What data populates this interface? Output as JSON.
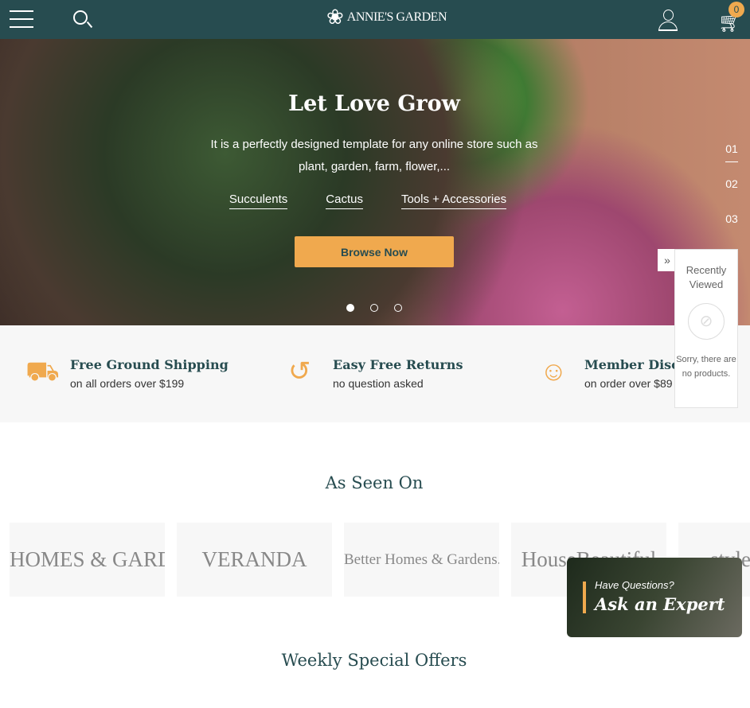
{
  "header": {
    "brand": "ANNIE'S GARDEN",
    "cart_count": "0"
  },
  "hero": {
    "title": "Let Love Grow",
    "subtitle": "It is a perfectly designed template for any online store such as plant, garden, farm, flower,...",
    "links": [
      "Succulents",
      "Cactus",
      "Tools + Accessories"
    ],
    "cta": "Browse Now",
    "slide_numbers": [
      "01",
      "02",
      "03"
    ],
    "active_slide": 1
  },
  "features": [
    {
      "title": "Free Ground Shipping",
      "text": "on all orders over $199",
      "icon": "truck-icon"
    },
    {
      "title": "Easy Free Returns",
      "text": "no question asked",
      "icon": "return-icon"
    },
    {
      "title": "Member Discount",
      "text": "on order over $89",
      "icon": "member-tag-icon"
    }
  ],
  "recently_viewed": {
    "title": "Recently Viewed",
    "empty": "Sorry, there are no products."
  },
  "as_seen_on": {
    "title": "As Seen On",
    "logos": [
      "HOMES & GARDENS",
      "VERANDA",
      "Better Homes & Gardens.",
      "HouseBeautiful",
      "stylecaster"
    ]
  },
  "weekly": {
    "title": "Weekly Special Offers"
  },
  "expert": {
    "question": "Have Questions?",
    "cta": "Ask an Expert"
  },
  "colors": {
    "primary": "#274c50",
    "accent": "#f0a94e"
  }
}
